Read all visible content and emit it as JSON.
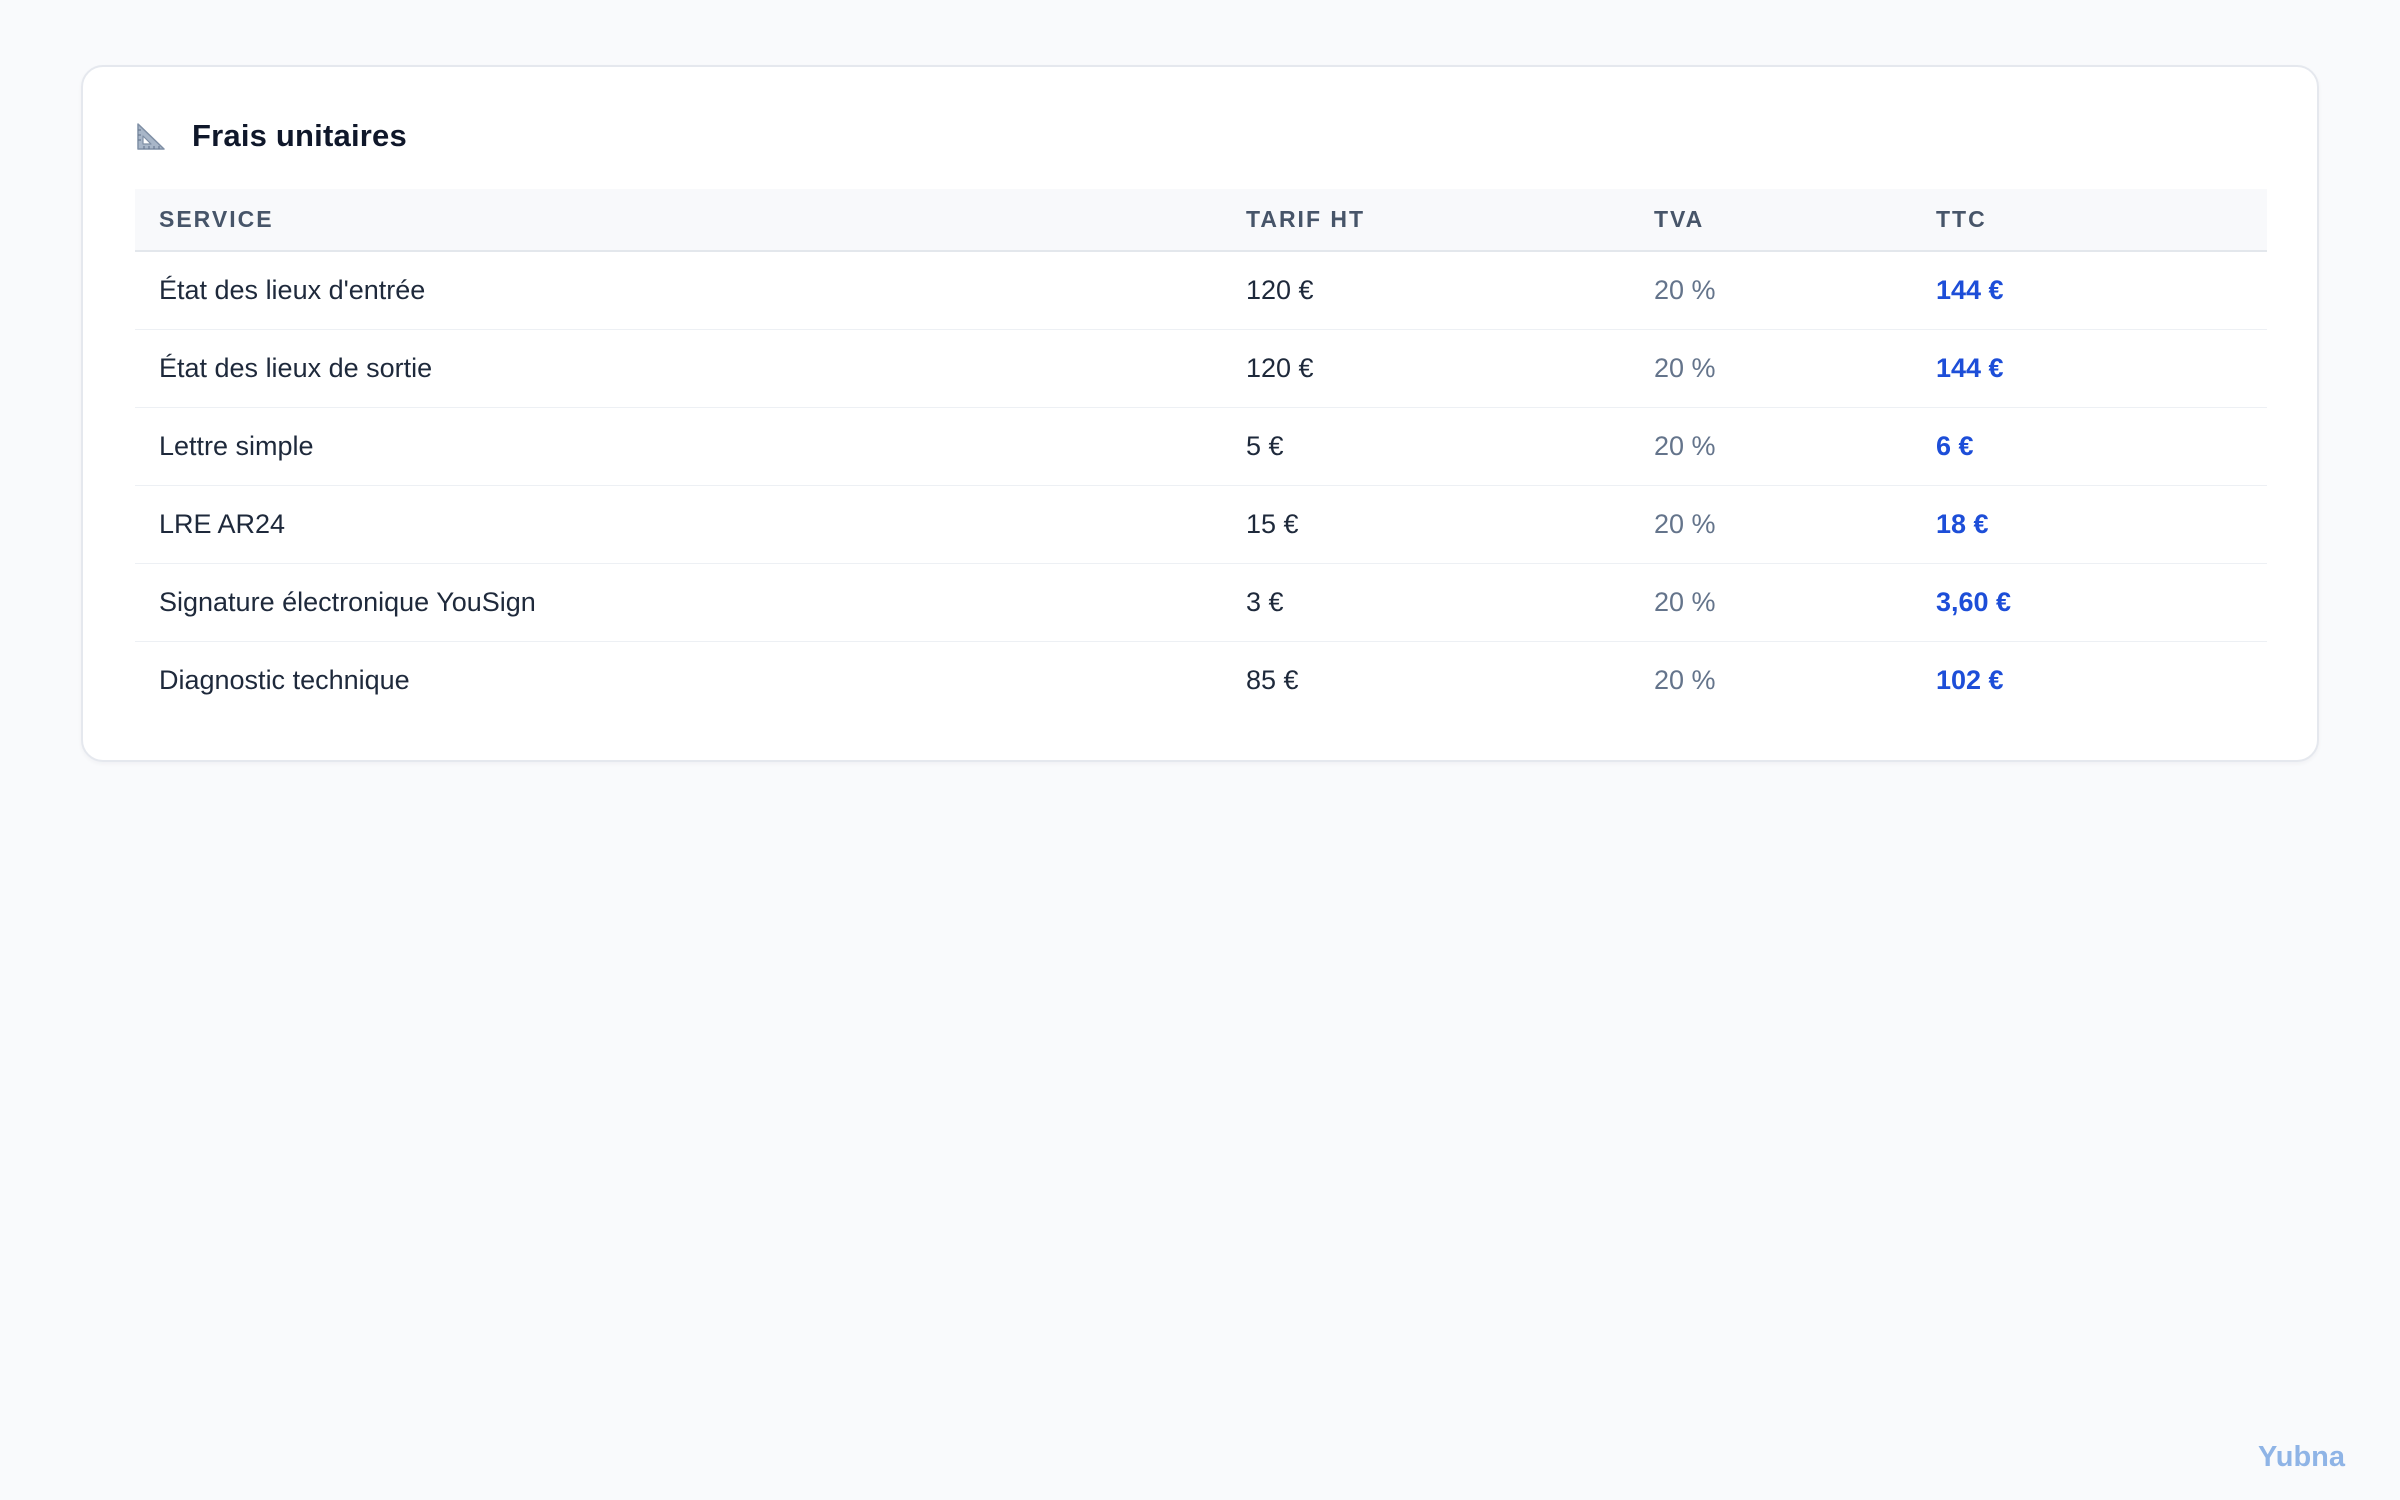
{
  "card": {
    "title": "Frais unitaires",
    "icon": "triangular-ruler-icon"
  },
  "table": {
    "columns": [
      "SERVICE",
      "TARIF HT",
      "TVA",
      "TTC"
    ],
    "rows": [
      {
        "service": "État des lieux d'entrée",
        "tarif_ht": "120 €",
        "tva": "20 %",
        "ttc": "144 €"
      },
      {
        "service": "État des lieux de sortie",
        "tarif_ht": "120 €",
        "tva": "20 %",
        "ttc": "144 €"
      },
      {
        "service": "Lettre simple",
        "tarif_ht": "5 €",
        "tva": "20 %",
        "ttc": "6 €"
      },
      {
        "service": "LRE AR24",
        "tarif_ht": "15 €",
        "tva": "20 %",
        "ttc": "18 €"
      },
      {
        "service": "Signature électronique YouSign",
        "tarif_ht": "3 €",
        "tva": "20 %",
        "ttc": "3,60 €"
      },
      {
        "service": "Diagnostic technique",
        "tarif_ht": "85 €",
        "tva": "20 %",
        "ttc": "102 €"
      }
    ]
  },
  "footer": {
    "brand": "Yubna"
  },
  "colors": {
    "background": "#f9fafc",
    "accent": "#1d4ed8",
    "brand": "#8fb4e6",
    "muted": "#64748b"
  }
}
